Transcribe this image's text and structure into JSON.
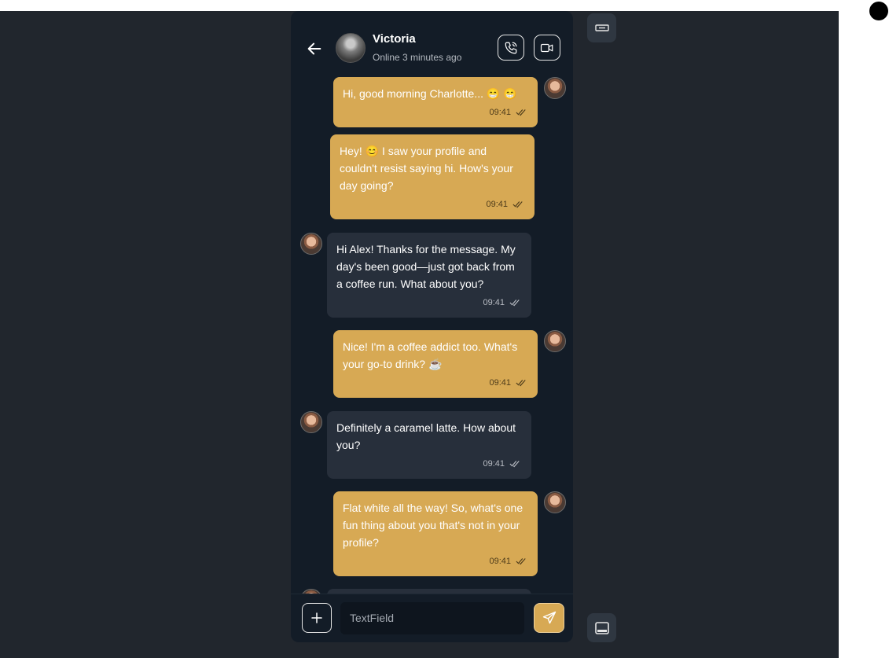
{
  "header": {
    "name": "Victoria",
    "status": "Online 3 minutes ago"
  },
  "messages": [
    {
      "direction": "out",
      "text": "Hi, good morning Charlotte... 😁 😁",
      "time": "09:41"
    },
    {
      "direction": "out",
      "text": "Hey! 😊 I saw your profile and couldn't resist saying hi. How's your day going?",
      "time": "09:41"
    },
    {
      "direction": "in",
      "text": "Hi Alex! Thanks for the message. My day's been good—just got back from a coffee run. What about you?",
      "time": "09:41"
    },
    {
      "direction": "out",
      "text": "Nice! I'm a coffee addict too. What's your go-to drink? ☕",
      "time": "09:41"
    },
    {
      "direction": "in",
      "text": "Definitely a caramel latte. How about you?",
      "time": "09:41"
    },
    {
      "direction": "out",
      "text": "Flat white all the way! So, what's one fun thing about you that's not in your profile?",
      "time": "09:41"
    }
  ],
  "composer": {
    "placeholder": "TextField"
  },
  "colors": {
    "outgoing_bubble": "#d7a954",
    "incoming_bubble": "#272f3b",
    "phone_bg": "#131c27",
    "stage_bg": "#21262d"
  },
  "icons": {
    "back": "arrow-left-icon",
    "call": "phone-icon",
    "video": "video-icon",
    "add": "plus-icon",
    "send": "send-icon",
    "read": "double-check-icon",
    "top_side": "keyboard-icon",
    "bottom_side": "window-icon"
  }
}
